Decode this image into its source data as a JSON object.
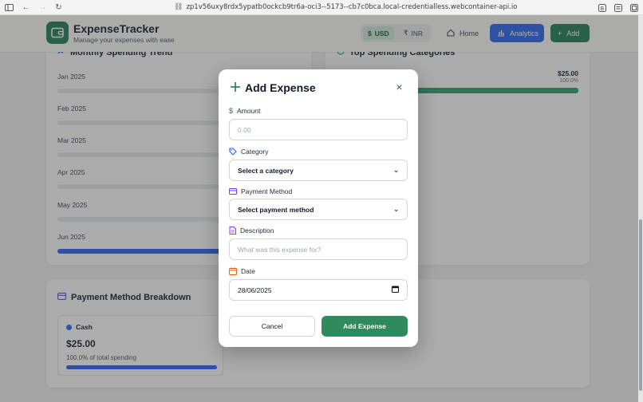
{
  "browser": {
    "url": "zp1v56uxy8rdx5ypatb0ockcb9tr6a-oci3--5173--cb7c0bca.local-credentialless.webcontainer-api.io"
  },
  "header": {
    "title": "ExpenseTracker",
    "subtitle": "Manage your expenses with ease",
    "currency_usd": "USD",
    "currency_inr": "INR",
    "currency_usd_symbol": "$",
    "currency_inr_symbol": "₹",
    "nav_home": "Home",
    "nav_analytics": "Analytics",
    "nav_add": "Add"
  },
  "trend": {
    "title": "Monthly Spending Trend",
    "months": [
      {
        "label": "Jan 2025",
        "fill": 0
      },
      {
        "label": "Feb 2025",
        "fill": 0
      },
      {
        "label": "Mar 2025",
        "fill": 0
      },
      {
        "label": "Apr 2025",
        "fill": 0
      },
      {
        "label": "May 2025",
        "fill": 0
      },
      {
        "label": "Jun 2025",
        "fill": 1.0
      }
    ]
  },
  "top_categories": {
    "title": "Top Spending Categories",
    "amount": "$25.00",
    "percent": "100.0%"
  },
  "payment_breakdown": {
    "title": "Payment Method Breakdown",
    "method": "Cash",
    "amount": "$25.00",
    "percent_text": "100.0% of total spending",
    "fill": 1.0
  },
  "modal": {
    "title": "Add Expense",
    "amount_label": "Amount",
    "amount_placeholder": "0.00",
    "category_label": "Category",
    "category_value": "Select a category",
    "payment_label": "Payment Method",
    "payment_value": "Select payment method",
    "description_label": "Description",
    "description_placeholder": "What was this expense for?",
    "date_label": "Date",
    "date_value": "28/06/2025",
    "cancel_label": "Cancel",
    "submit_label": "Add Expense"
  },
  "colors": {
    "primary_green": "#1e7a55",
    "primary_blue": "#2563eb"
  }
}
